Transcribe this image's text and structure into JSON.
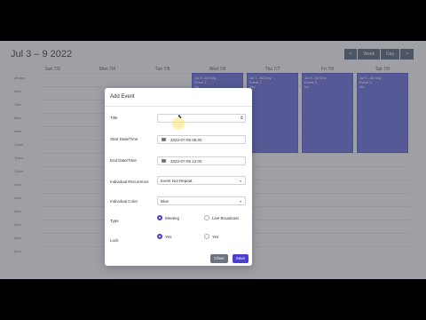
{
  "calendar": {
    "title": "Jul 3 – 9 2022",
    "nav": [
      "<",
      "Week",
      "Day",
      ">"
    ],
    "days": [
      "Sun 7/3",
      "Mon 7/4",
      "Tue 7/5",
      "Wed 7/6",
      "Thu 7/7",
      "Fri 7/8",
      "Sat 7/9"
    ],
    "times": [
      "all-day",
      "6am",
      "7am",
      "8am",
      "9am",
      "10am",
      "11am",
      "12pm",
      "1pm",
      "2pm",
      "3pm",
      "4pm",
      "5pm",
      "6pm"
    ],
    "events": [
      {
        "title": "Jul 6 - All Day",
        "line2": "Event 1",
        "line3": "No"
      },
      {
        "title": "Jul 7 - All Day",
        "line2": "Event 2",
        "line3": "Yes"
      },
      {
        "title": "Jul 8 - All Day",
        "line2": "Event 3",
        "line3": "No"
      },
      {
        "title": "Jul 9 - All Day",
        "line2": "Event 4",
        "line3": "No"
      }
    ]
  },
  "dialog": {
    "title": "Add Event",
    "fields": {
      "title_label": "Title",
      "title_value": "",
      "start_label": "Start Date/Time",
      "start_value": "2022-07-06 06:00",
      "end_label": "End Date/Time",
      "end_value": "2022-07-06 12:00",
      "recurrence_label": "Individual Recurrence",
      "recurrence_value": "Event Not Repeat",
      "color_label": "Individual Color",
      "color_value": "Blue",
      "type_label": "Type",
      "type_options": [
        "Meeting",
        "Live Broadcast"
      ],
      "lock_label": "Lock",
      "lock_options": [
        "Yes",
        "Yes"
      ]
    },
    "buttons": {
      "close": "Close",
      "save": "Save"
    }
  },
  "colors": {
    "accent": "#4b3fd0",
    "event": "#6a74d8"
  }
}
